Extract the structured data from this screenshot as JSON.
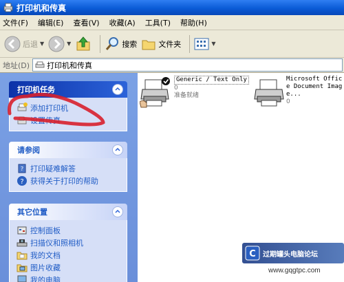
{
  "window": {
    "title": "打印机和传真"
  },
  "menu": [
    {
      "label": "文件(F)"
    },
    {
      "label": "编辑(E)"
    },
    {
      "label": "查看(V)"
    },
    {
      "label": "收藏(A)"
    },
    {
      "label": "工具(T)"
    },
    {
      "label": "帮助(H)"
    }
  ],
  "toolbar": {
    "back_label": "后退",
    "search_label": "搜索",
    "folders_label": "文件夹"
  },
  "address": {
    "label": "地址(D)",
    "value": "打印机和传真"
  },
  "tasks": {
    "header": "打印机任务",
    "items": [
      {
        "label": "添加打印机"
      },
      {
        "label": "设置传真"
      }
    ]
  },
  "seealso": {
    "header": "请参阅",
    "items": [
      {
        "label": "打印疑难解答"
      },
      {
        "label": "获得关于打印的帮助"
      }
    ]
  },
  "other": {
    "header": "其它位置",
    "items": [
      {
        "label": "控制面板"
      },
      {
        "label": "扫描仪和照相机"
      },
      {
        "label": "我的文档"
      },
      {
        "label": "图片收藏"
      },
      {
        "label": "我的电脑"
      }
    ]
  },
  "printers": [
    {
      "name": "Generic / Text Only",
      "count": "0",
      "status": "准备就绪",
      "default": true
    },
    {
      "name": "Microsoft Office Document Image...",
      "count": "0",
      "status": "",
      "default": false
    }
  ],
  "watermark": {
    "text": "过期罐头电脑论坛",
    "url": "www.gqgtpc.com"
  },
  "colors": {
    "titlebar": "#0a5bd6",
    "panel_link": "#215dc6",
    "left_bg": "#6a8fda"
  }
}
